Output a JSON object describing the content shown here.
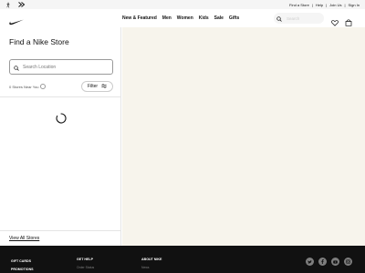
{
  "utility_bar": {
    "links": [
      "Find a Store",
      "Help",
      "Join Us",
      "Sign In"
    ]
  },
  "nav": {
    "menu": [
      "New & Featured",
      "Men",
      "Women",
      "Kids",
      "Sale",
      "Gifts"
    ],
    "search_placeholder": "Search"
  },
  "store_panel": {
    "title": "Find a Nike Store",
    "search_placeholder": "Search Location",
    "near_label": "0 Stores Near You",
    "filter_label": "Filter",
    "view_all": "View All Stores"
  },
  "footer": {
    "columns": [
      {
        "title": "GIFT CARDS"
      },
      {
        "title": "PROMOTIONS"
      },
      {
        "title": "GET HELP",
        "sub": "Order Status"
      },
      {
        "title": "ABOUT NIKE",
        "sub": "News"
      }
    ],
    "social_icons": [
      "twitter-icon",
      "facebook-icon",
      "youtube-icon",
      "instagram-icon"
    ]
  },
  "colors": {
    "map_background": "#f7f4ec",
    "footer_background": "#111111",
    "utility_background": "#f5f5f5"
  }
}
